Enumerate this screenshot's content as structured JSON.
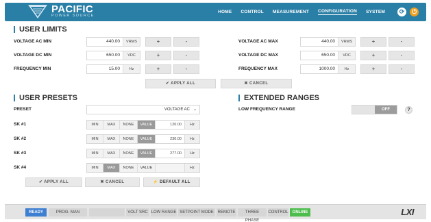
{
  "header": {
    "brand": "PACIFIC",
    "brand_sub": "POWER SOURCE",
    "nav": [
      "HOME",
      "CONTROL",
      "MEASUREMENT",
      "CONFIGURATION",
      "SYSTEM"
    ],
    "active_nav": "CONFIGURATION",
    "accent_color": "#2a7fa6",
    "icons": [
      "refresh-icon",
      "power-icon"
    ]
  },
  "user_limits": {
    "title": "USER LIMITS",
    "rows_left": [
      {
        "label": "VOLTAGE AC MIN",
        "value": "440.00",
        "unit": "VRMS"
      },
      {
        "label": "VOLTAGE DC MIN",
        "value": "650.00",
        "unit": "VDC"
      },
      {
        "label": "FREQUENCY MIN",
        "value": "15.00",
        "unit": "Hz"
      }
    ],
    "rows_right": [
      {
        "label": "VOLTAGE AC MAX",
        "value": "440.00",
        "unit": "VRMS"
      },
      {
        "label": "VOLTAGE DC MAX",
        "value": "650.00",
        "unit": "VDC"
      },
      {
        "label": "FREQUENCY MAX",
        "value": "1000.00",
        "unit": "Hz"
      }
    ],
    "plus": "+",
    "minus": "-",
    "apply_all": "✔  APPLY ALL",
    "cancel": "✖  CANCEL"
  },
  "user_presets": {
    "title": "USER PRESETS",
    "preset_label": "PRESET",
    "preset_value": "VOLTAGE AC",
    "modes": [
      "MIN",
      "MAX",
      "NONE",
      "VALUE"
    ],
    "rows": [
      {
        "label": "SK #1",
        "active": "VALUE",
        "value": "120.00",
        "unit": "Hz"
      },
      {
        "label": "SK #2",
        "active": "VALUE",
        "value": "230.00",
        "unit": "Hz"
      },
      {
        "label": "SK #3",
        "active": "VALUE",
        "value": "277.00",
        "unit": "Hz"
      },
      {
        "label": "SK #4",
        "active": "MAX",
        "value": "",
        "unit": "Hz"
      }
    ],
    "apply_all": "✔  APPLY ALL",
    "cancel": "✖  CANCEL",
    "default_all": "⚡  DEFAULT ALL"
  },
  "extended_ranges": {
    "title": "EXTENDED RANGES",
    "low_freq_label": "LOW FREQUENCY RANGE",
    "toggle_state": "OFF",
    "help": "?"
  },
  "status_bar": {
    "items": [
      "READY",
      "PROG. MAN",
      "",
      "VOLT SRC",
      "LOW RANGE",
      "SETPOINT MODE",
      "REMOTE",
      "THREE PHASE",
      "CONTROL",
      "ONLINE"
    ],
    "logo": "LXI"
  }
}
